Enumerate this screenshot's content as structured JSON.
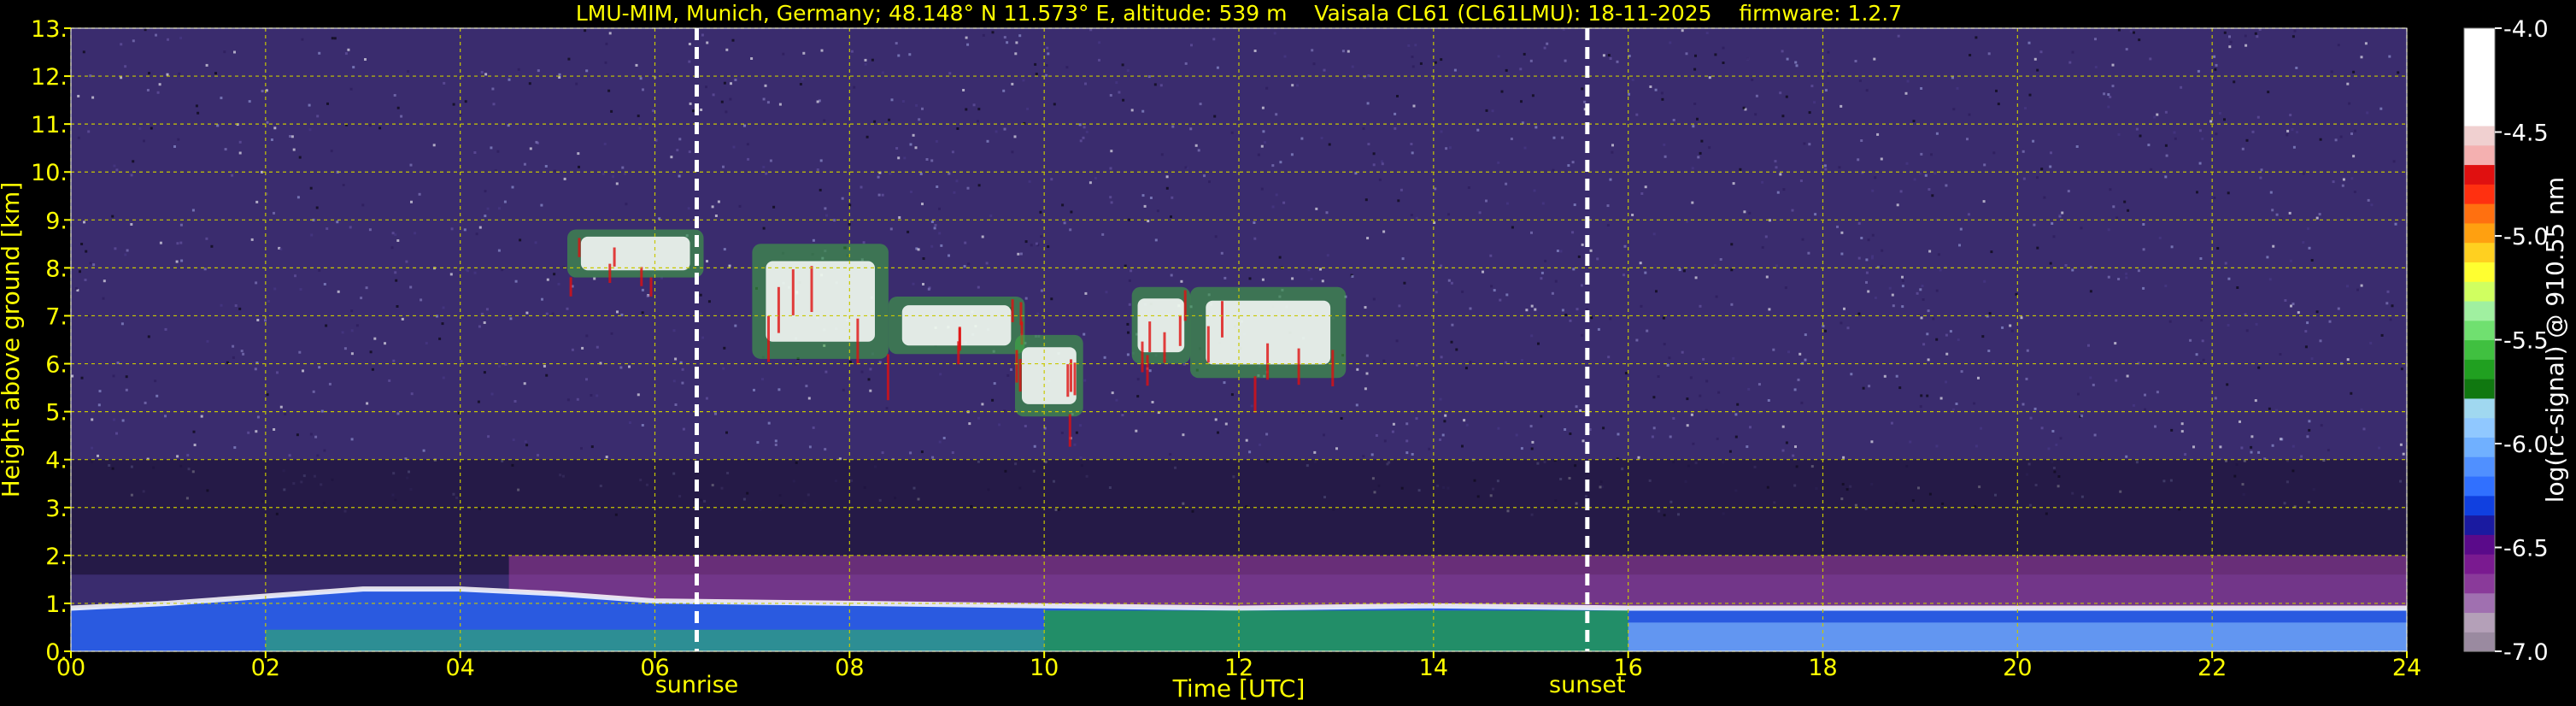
{
  "chart_data": {
    "type": "heatmap",
    "title": "LMU-MIM, Munich, Germany; 48.148° N 11.573° E, altitude: 539 m    Vaisala CL61 (CL61LMU): 18-11-2025    firmware: 1.2.7",
    "xlabel": "Time [UTC]",
    "ylabel": "Height above ground [km]",
    "xlim": [
      0,
      24
    ],
    "ylim": [
      0,
      13
    ],
    "x_ticks": [
      "00",
      "02",
      "04",
      "06",
      "08",
      "10",
      "12",
      "14",
      "16",
      "18",
      "20",
      "22",
      "24"
    ],
    "y_ticks": [
      "0.",
      "1.",
      "2.",
      "3.",
      "4.",
      "5.",
      "6.",
      "7.",
      "8.",
      "9.",
      "10.",
      "11.",
      "12.",
      "13."
    ],
    "grid": true,
    "events": [
      {
        "label": "sunrise",
        "time": 6.43
      },
      {
        "label": "sunset",
        "time": 15.58
      }
    ],
    "colorbar": {
      "label": "log(rc-signal) @ 910.55 nm",
      "range": [
        -7.0,
        -4.0
      ],
      "ticks": [
        "-7.0",
        "-6.5",
        "-6.0",
        "-5.5",
        "-5.0",
        "-4.5",
        "-4.0"
      ],
      "colors": [
        "#9a8aa0",
        "#b4a0b8",
        "#a070b0",
        "#8a3a9a",
        "#7a1a90",
        "#5a0a8a",
        "#1a1aa0",
        "#1040e0",
        "#3070ff",
        "#5090ff",
        "#70b0ff",
        "#90c8ff",
        "#a0d8f0",
        "#107810",
        "#20a020",
        "#40c040",
        "#70e070",
        "#a0f0a0",
        "#d0ff60",
        "#ffff30",
        "#ffd020",
        "#ffa010",
        "#ff7010",
        "#ff3010",
        "#e01010",
        "#f4b0b0",
        "#f0d0d0",
        "#ffffff",
        "#ffffff",
        "#ffffff",
        "#ffffff",
        "#ffffff"
      ]
    },
    "cloud_layers": [
      {
        "start": 5.1,
        "end": 6.5,
        "base_km": 7.8,
        "top_km": 8.8
      },
      {
        "start": 7.0,
        "end": 8.4,
        "base_km": 6.1,
        "top_km": 8.5
      },
      {
        "start": 8.4,
        "end": 9.8,
        "base_km": 6.2,
        "top_km": 7.4
      },
      {
        "start": 9.7,
        "end": 10.4,
        "base_km": 4.9,
        "top_km": 6.6
      },
      {
        "start": 10.9,
        "end": 11.5,
        "base_km": 6.0,
        "top_km": 7.6
      },
      {
        "start": 11.5,
        "end": 13.1,
        "base_km": 5.7,
        "top_km": 7.6
      }
    ],
    "boundary_layer": [
      {
        "time": 0.0,
        "top_km": 0.9
      },
      {
        "time": 1.0,
        "top_km": 1.0
      },
      {
        "time": 2.0,
        "top_km": 1.15
      },
      {
        "time": 3.0,
        "top_km": 1.3
      },
      {
        "time": 4.0,
        "top_km": 1.3
      },
      {
        "time": 5.0,
        "top_km": 1.2
      },
      {
        "time": 6.0,
        "top_km": 1.05
      },
      {
        "time": 8.0,
        "top_km": 1.0
      },
      {
        "time": 10.0,
        "top_km": 0.95
      },
      {
        "time": 12.0,
        "top_km": 0.9
      },
      {
        "time": 14.0,
        "top_km": 0.95
      },
      {
        "time": 16.0,
        "top_km": 0.9
      },
      {
        "time": 20.0,
        "top_km": 0.9
      },
      {
        "time": 24.0,
        "top_km": 0.9
      }
    ]
  }
}
